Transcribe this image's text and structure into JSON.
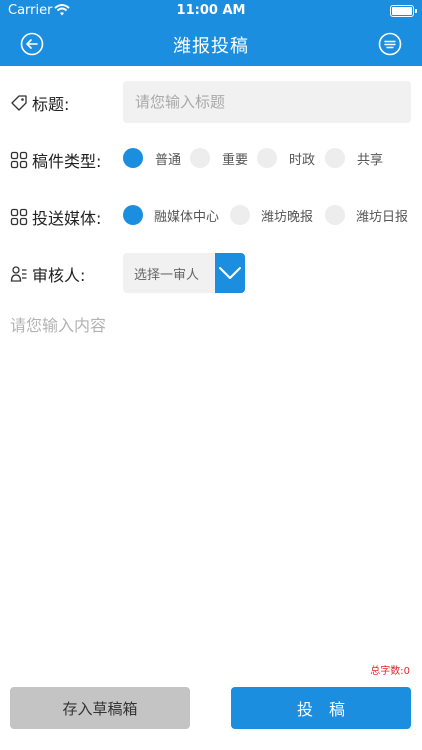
{
  "status_bar": {
    "carrier": "Carrier",
    "time": "11:00 AM",
    "icons": [
      "wifi-icon",
      "battery-icon"
    ]
  },
  "nav": {
    "title": "潍报投稿",
    "back_icon": "back-arrow-icon",
    "menu_icon": "menu-icon"
  },
  "form": {
    "title_label": "标题:",
    "title_placeholder": "请您输入标题",
    "type_label": "稿件类型:",
    "types": [
      {
        "label": "普通",
        "selected": true
      },
      {
        "label": "重要",
        "selected": false
      },
      {
        "label": "时政",
        "selected": false
      },
      {
        "label": "共享",
        "selected": false
      }
    ],
    "media_label": "投送媒体:",
    "media": [
      {
        "label": "融媒体中心",
        "selected": true
      },
      {
        "label": "潍坊晚报",
        "selected": false
      },
      {
        "label": "潍坊日报",
        "selected": false
      }
    ],
    "reviewer_label": "审核人:",
    "reviewer_value": "选择一审人",
    "content_placeholder": "请您输入内容",
    "word_count": "总字数:0"
  },
  "buttons": {
    "draft": "存入草稿箱",
    "submit": "投　稿"
  },
  "colors": {
    "accent": "#1c8ee0",
    "unselected": "#ededed",
    "count": "#e02a2a",
    "draft_button": "#c4c4c4"
  }
}
